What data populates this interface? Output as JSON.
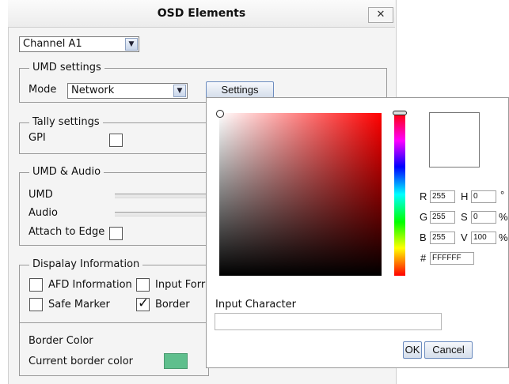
{
  "dialog": {
    "title": "OSD Elements",
    "close_label": "✕"
  },
  "channel_select": {
    "value": "Channel A1"
  },
  "umd_settings": {
    "legend": "UMD settings",
    "mode_label": "Mode",
    "mode_value": "Network",
    "settings_button": "Settings"
  },
  "tally_settings": {
    "legend": "Tally settings",
    "gpi_label": "GPI",
    "gpi_checked": false
  },
  "umd_audio": {
    "legend": "UMD & Audio",
    "umd_label": "UMD",
    "audio_label": "Audio",
    "attach_label": "Attach to Edge",
    "attach_checked": false
  },
  "display_info": {
    "legend": "Dispalay Information",
    "options": [
      {
        "label": "AFD Information",
        "checked": false
      },
      {
        "label": "Input Forr",
        "checked": false
      },
      {
        "label": "Safe Marker",
        "checked": false
      },
      {
        "label": "Border",
        "checked": true
      }
    ]
  },
  "border_color": {
    "title": "Border Color",
    "current_label": "Current border color",
    "current_color": "#5fbf8d"
  },
  "color_picker": {
    "hue_color": "#ff0000",
    "preview_color": "#ffffff",
    "fields": {
      "r_label": "R",
      "r_value": "255",
      "g_label": "G",
      "g_value": "255",
      "b_label": "B",
      "b_value": "255",
      "h_label": "H",
      "h_value": "0",
      "h_unit": "°",
      "s_label": "S",
      "s_value": "0",
      "s_unit": "%",
      "v_label": "V",
      "v_value": "100",
      "v_unit": "%",
      "hex_label": "#",
      "hex_value": "FFFFFF"
    },
    "input_character_label": "Input Character",
    "input_character_value": "",
    "ok_button": "OK",
    "cancel_button": "Cancel"
  }
}
